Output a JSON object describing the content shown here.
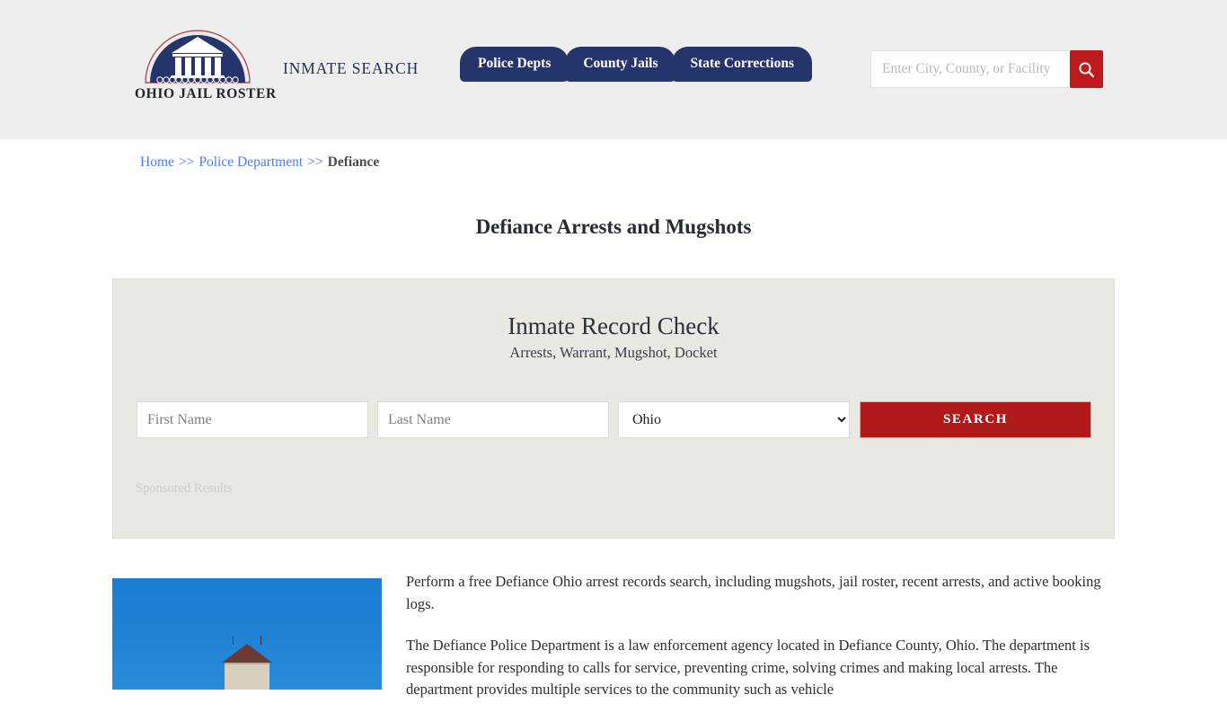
{
  "header": {
    "logo": {
      "icon": "courthouse-dome-logo",
      "text": "OHIO JAIL ROSTER"
    },
    "site_label": "INMATE SEARCH",
    "nav_tabs": [
      {
        "label": "Police Depts"
      },
      {
        "label": "County Jails"
      },
      {
        "label": "State Corrections"
      }
    ],
    "search": {
      "placeholder": "Enter City, County, or Facility",
      "value": "",
      "icon": "search-icon",
      "button_color": "#c0191c"
    },
    "background_color": "#eeeeee"
  },
  "breadcrumb": {
    "items": [
      {
        "label": "Home",
        "link": true
      },
      {
        "label": "Police Department",
        "link": true
      },
      {
        "label": "Defiance",
        "link": false
      }
    ],
    "separator": ">>",
    "link_color": "#4a7df0"
  },
  "page": {
    "title": "Defiance Arrests and Mugshots"
  },
  "record_check": {
    "title": "Inmate Record Check",
    "subtitle": "Arrests, Warrant, Mugshot, Docket",
    "first_name": {
      "placeholder": "First Name",
      "value": ""
    },
    "last_name": {
      "placeholder": "Last Name",
      "value": ""
    },
    "state": {
      "selected": "Ohio",
      "options": [
        "Ohio"
      ]
    },
    "search_button": "SEARCH",
    "sponsored_label": "Sponsored Results",
    "card_color": "#eae8e3",
    "button_color": "#b01a1a"
  },
  "content": {
    "photo_alt": "defiance-courthouse-tower-photo",
    "paragraphs": [
      "Perform a free Defiance Ohio arrest records search, including mugshots, jail roster, recent arrests, and active booking logs.",
      "The Defiance Police Department is a law enforcement agency located in Defiance County, Ohio. The department is responsible for responding to calls for service, preventing crime, solving crimes and making local arrests. The department provides multiple services to the community such as vehicle"
    ]
  }
}
